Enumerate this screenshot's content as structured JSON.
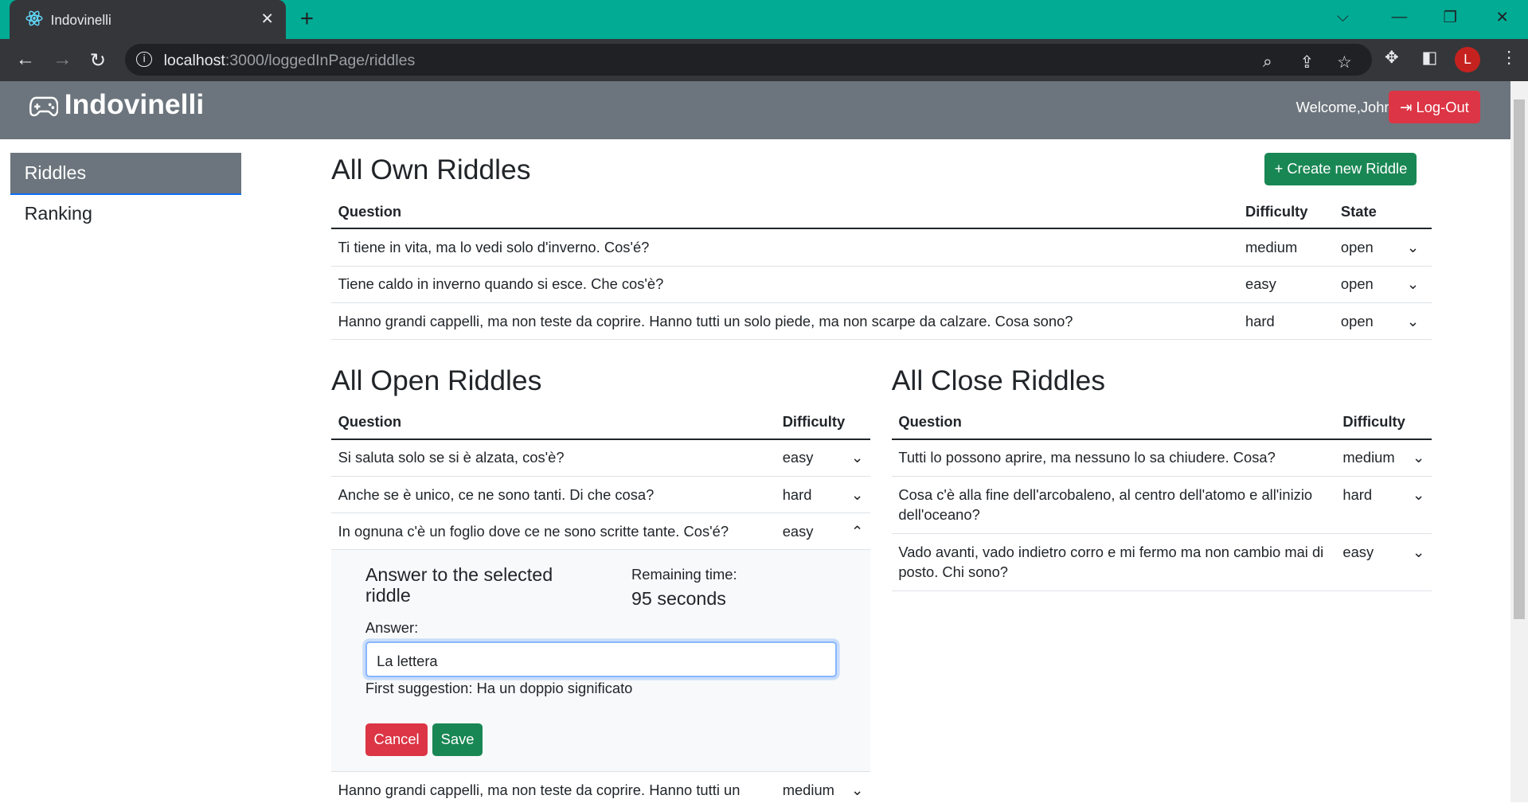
{
  "browser": {
    "tab_title": "Indovinelli",
    "url_host": "localhost",
    "url_path": ":3000/loggedInPage/riddles",
    "avatar_letter": "L"
  },
  "app": {
    "brand": "Indovinelli",
    "welcome": "Welcome,John",
    "logout": "Log-Out"
  },
  "sidebar": {
    "items": [
      {
        "label": "Riddles"
      },
      {
        "label": "Ranking"
      }
    ]
  },
  "own": {
    "title": "All Own Riddles",
    "create": "+ Create new Riddle",
    "headers": [
      "Question",
      "Difficulty",
      "State"
    ],
    "rows": [
      {
        "question": "Ti tiene in vita, ma lo vedi solo d'inverno. Cos'é?",
        "difficulty": "medium",
        "state": "open"
      },
      {
        "question": "Tiene caldo in inverno quando si esce. Che cos'è?",
        "difficulty": "easy",
        "state": "open"
      },
      {
        "question": "Hanno grandi cappelli, ma non teste da coprire. Hanno tutti un solo piede, ma non scarpe da calzare. Cosa sono?",
        "difficulty": "hard",
        "state": "open"
      }
    ]
  },
  "open": {
    "title": "All Open Riddles",
    "headers": [
      "Question",
      "Difficulty"
    ],
    "rows": [
      {
        "question": "Si saluta solo se si è alzata, cos'è?",
        "difficulty": "easy"
      },
      {
        "question": "Anche se è unico, ce ne sono tanti. Di che cosa?",
        "difficulty": "hard"
      },
      {
        "question": "In ognuna c'è un foglio dove ce ne sono scritte tante. Cos'é?",
        "difficulty": "easy"
      },
      {
        "question": "Hanno grandi cappelli, ma non teste da coprire. Hanno tutti un solo",
        "difficulty": "medium"
      }
    ],
    "answer_panel": {
      "title": "Answer to the selected riddle",
      "remaining_label": "Remaining time:",
      "remaining_value": "95 seconds",
      "answer_label": "Answer:",
      "answer_value": "La lettera",
      "suggestion": "First suggestion: Ha un doppio significato",
      "cancel": "Cancel",
      "save": "Save"
    }
  },
  "close": {
    "title": "All Close Riddles",
    "headers": [
      "Question",
      "Difficulty"
    ],
    "rows": [
      {
        "question": "Tutti lo possono aprire, ma nessuno lo sa chiudere. Cosa?",
        "difficulty": "medium"
      },
      {
        "question": "Cosa c'è alla fine dell'arcobaleno, al centro dell'atomo e all'inizio dell'oceano?",
        "difficulty": "hard"
      },
      {
        "question": "Vado avanti, vado indietro corro e mi fermo ma non cambio mai di posto. Chi sono?",
        "difficulty": "easy"
      }
    ]
  }
}
